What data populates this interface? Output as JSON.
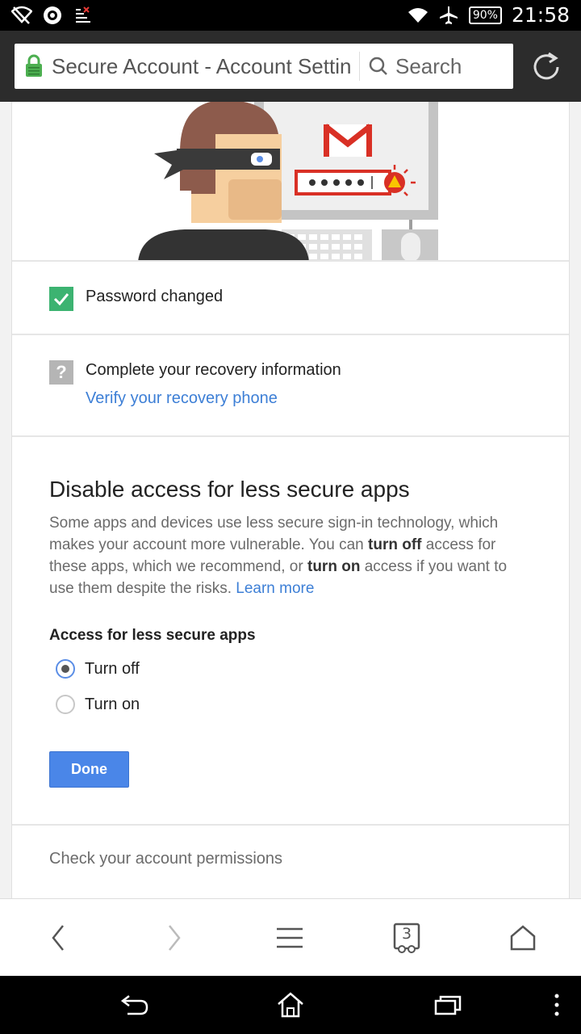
{
  "status_bar": {
    "icons_left": [
      "wifi-off-icon",
      "app-icon",
      "signal-x-icon"
    ],
    "icons_right": [
      "wifi-icon",
      "airplane-icon"
    ],
    "battery": "90%",
    "time": "21:58"
  },
  "browser": {
    "url_title": "Secure Account - Account Settin",
    "search_label": "Search",
    "lock_color": "#4caf50"
  },
  "content": {
    "password_status": "Password changed",
    "recovery_title": "Complete your recovery information",
    "recovery_link": "Verify your recovery phone",
    "section_title": "Disable access for less secure apps",
    "desc_part1": "Some apps and devices use less secure sign-in technology, which makes your account more vulnerable. You can ",
    "desc_bold1": "turn off",
    "desc_part2": " access for these apps, which we recommend, or ",
    "desc_bold2": "turn on",
    "desc_part3": " access if you want to use them despite the risks. ",
    "learn_more": "Learn more",
    "access_label": "Access for less secure apps",
    "options": [
      {
        "label": "Turn off",
        "selected": true
      },
      {
        "label": "Turn on",
        "selected": false
      }
    ],
    "done_label": "Done",
    "permissions_text": "Check your account permissions"
  },
  "bottom_bar": {
    "tab_count": "3"
  },
  "colors": {
    "link": "#3d7fd6",
    "done_button": "#4a86e8",
    "check_green": "#3cb371"
  }
}
